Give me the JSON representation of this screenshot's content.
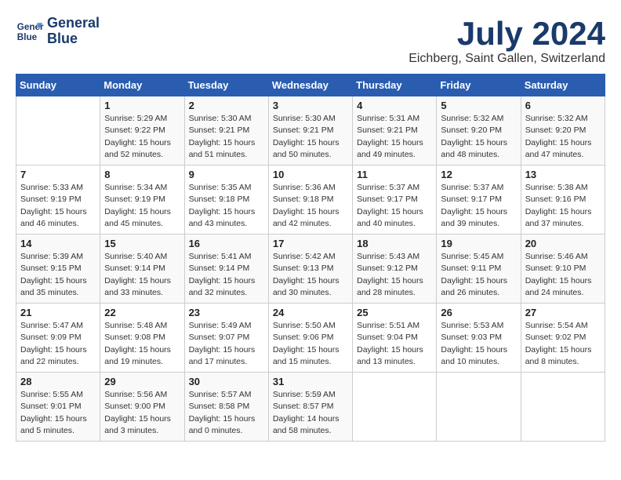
{
  "logo": {
    "line1": "General",
    "line2": "Blue"
  },
  "title": "July 2024",
  "location": "Eichberg, Saint Gallen, Switzerland",
  "weekdays": [
    "Sunday",
    "Monday",
    "Tuesday",
    "Wednesday",
    "Thursday",
    "Friday",
    "Saturday"
  ],
  "weeks": [
    [
      {
        "day": "",
        "info": ""
      },
      {
        "day": "1",
        "info": "Sunrise: 5:29 AM\nSunset: 9:22 PM\nDaylight: 15 hours\nand 52 minutes."
      },
      {
        "day": "2",
        "info": "Sunrise: 5:30 AM\nSunset: 9:21 PM\nDaylight: 15 hours\nand 51 minutes."
      },
      {
        "day": "3",
        "info": "Sunrise: 5:30 AM\nSunset: 9:21 PM\nDaylight: 15 hours\nand 50 minutes."
      },
      {
        "day": "4",
        "info": "Sunrise: 5:31 AM\nSunset: 9:21 PM\nDaylight: 15 hours\nand 49 minutes."
      },
      {
        "day": "5",
        "info": "Sunrise: 5:32 AM\nSunset: 9:20 PM\nDaylight: 15 hours\nand 48 minutes."
      },
      {
        "day": "6",
        "info": "Sunrise: 5:32 AM\nSunset: 9:20 PM\nDaylight: 15 hours\nand 47 minutes."
      }
    ],
    [
      {
        "day": "7",
        "info": "Sunrise: 5:33 AM\nSunset: 9:19 PM\nDaylight: 15 hours\nand 46 minutes."
      },
      {
        "day": "8",
        "info": "Sunrise: 5:34 AM\nSunset: 9:19 PM\nDaylight: 15 hours\nand 45 minutes."
      },
      {
        "day": "9",
        "info": "Sunrise: 5:35 AM\nSunset: 9:18 PM\nDaylight: 15 hours\nand 43 minutes."
      },
      {
        "day": "10",
        "info": "Sunrise: 5:36 AM\nSunset: 9:18 PM\nDaylight: 15 hours\nand 42 minutes."
      },
      {
        "day": "11",
        "info": "Sunrise: 5:37 AM\nSunset: 9:17 PM\nDaylight: 15 hours\nand 40 minutes."
      },
      {
        "day": "12",
        "info": "Sunrise: 5:37 AM\nSunset: 9:17 PM\nDaylight: 15 hours\nand 39 minutes."
      },
      {
        "day": "13",
        "info": "Sunrise: 5:38 AM\nSunset: 9:16 PM\nDaylight: 15 hours\nand 37 minutes."
      }
    ],
    [
      {
        "day": "14",
        "info": "Sunrise: 5:39 AM\nSunset: 9:15 PM\nDaylight: 15 hours\nand 35 minutes."
      },
      {
        "day": "15",
        "info": "Sunrise: 5:40 AM\nSunset: 9:14 PM\nDaylight: 15 hours\nand 33 minutes."
      },
      {
        "day": "16",
        "info": "Sunrise: 5:41 AM\nSunset: 9:14 PM\nDaylight: 15 hours\nand 32 minutes."
      },
      {
        "day": "17",
        "info": "Sunrise: 5:42 AM\nSunset: 9:13 PM\nDaylight: 15 hours\nand 30 minutes."
      },
      {
        "day": "18",
        "info": "Sunrise: 5:43 AM\nSunset: 9:12 PM\nDaylight: 15 hours\nand 28 minutes."
      },
      {
        "day": "19",
        "info": "Sunrise: 5:45 AM\nSunset: 9:11 PM\nDaylight: 15 hours\nand 26 minutes."
      },
      {
        "day": "20",
        "info": "Sunrise: 5:46 AM\nSunset: 9:10 PM\nDaylight: 15 hours\nand 24 minutes."
      }
    ],
    [
      {
        "day": "21",
        "info": "Sunrise: 5:47 AM\nSunset: 9:09 PM\nDaylight: 15 hours\nand 22 minutes."
      },
      {
        "day": "22",
        "info": "Sunrise: 5:48 AM\nSunset: 9:08 PM\nDaylight: 15 hours\nand 19 minutes."
      },
      {
        "day": "23",
        "info": "Sunrise: 5:49 AM\nSunset: 9:07 PM\nDaylight: 15 hours\nand 17 minutes."
      },
      {
        "day": "24",
        "info": "Sunrise: 5:50 AM\nSunset: 9:06 PM\nDaylight: 15 hours\nand 15 minutes."
      },
      {
        "day": "25",
        "info": "Sunrise: 5:51 AM\nSunset: 9:04 PM\nDaylight: 15 hours\nand 13 minutes."
      },
      {
        "day": "26",
        "info": "Sunrise: 5:53 AM\nSunset: 9:03 PM\nDaylight: 15 hours\nand 10 minutes."
      },
      {
        "day": "27",
        "info": "Sunrise: 5:54 AM\nSunset: 9:02 PM\nDaylight: 15 hours\nand 8 minutes."
      }
    ],
    [
      {
        "day": "28",
        "info": "Sunrise: 5:55 AM\nSunset: 9:01 PM\nDaylight: 15 hours\nand 5 minutes."
      },
      {
        "day": "29",
        "info": "Sunrise: 5:56 AM\nSunset: 9:00 PM\nDaylight: 15 hours\nand 3 minutes."
      },
      {
        "day": "30",
        "info": "Sunrise: 5:57 AM\nSunset: 8:58 PM\nDaylight: 15 hours\nand 0 minutes."
      },
      {
        "day": "31",
        "info": "Sunrise: 5:59 AM\nSunset: 8:57 PM\nDaylight: 14 hours\nand 58 minutes."
      },
      {
        "day": "",
        "info": ""
      },
      {
        "day": "",
        "info": ""
      },
      {
        "day": "",
        "info": ""
      }
    ]
  ]
}
